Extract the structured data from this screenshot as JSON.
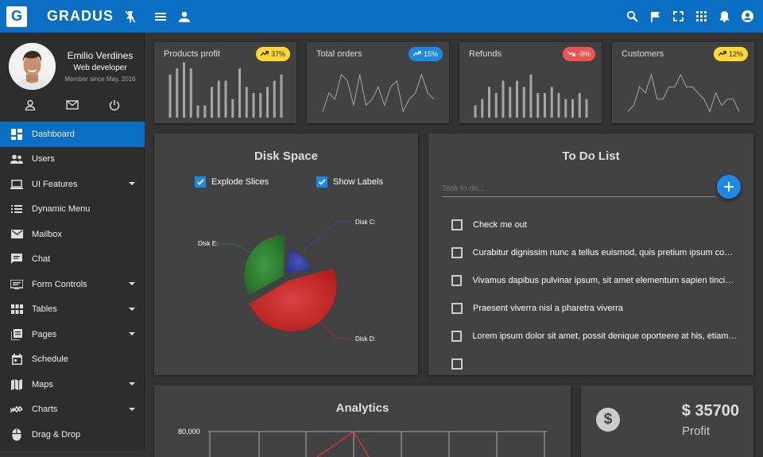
{
  "app": {
    "brand": "GRADUS",
    "logo_letter": "G"
  },
  "profile": {
    "name": "Emilio Verdines",
    "role": "Web developer",
    "member_since": "Member since May. 2016"
  },
  "sidebar": {
    "items": [
      {
        "label": "Dashboard",
        "icon": "dashboard-icon",
        "active": true
      },
      {
        "label": "Users",
        "icon": "users-icon"
      },
      {
        "label": "UI Features",
        "icon": "laptop-icon",
        "expand": true
      },
      {
        "label": "Dynamic Menu",
        "icon": "list-icon"
      },
      {
        "label": "Mailbox",
        "icon": "mail-icon"
      },
      {
        "label": "Chat",
        "icon": "chat-icon"
      },
      {
        "label": "Form Controls",
        "icon": "form-icon",
        "expand": true
      },
      {
        "label": "Tables",
        "icon": "table-icon",
        "expand": true
      },
      {
        "label": "Pages",
        "icon": "pages-icon",
        "expand": true
      },
      {
        "label": "Schedule",
        "icon": "calendar-icon"
      },
      {
        "label": "Maps",
        "icon": "map-icon",
        "expand": true
      },
      {
        "label": "Charts",
        "icon": "chart-icon",
        "expand": true
      },
      {
        "label": "Drag & Drop",
        "icon": "mouse-icon"
      }
    ]
  },
  "stats": [
    {
      "title": "Products profit",
      "badge": "37%",
      "trend": "up",
      "color": "#fdd835",
      "type": "bar",
      "values": [
        7,
        8,
        9,
        8,
        2,
        2,
        5,
        6,
        6,
        3,
        8,
        5,
        4,
        4,
        5,
        6,
        7
      ]
    },
    {
      "title": "Total orders",
      "badge": "15%",
      "trend": "up",
      "color": "#1e88e5",
      "type": "line",
      "values": [
        1,
        4,
        3,
        7,
        6,
        2,
        7,
        2,
        3,
        5,
        2,
        5,
        6,
        1,
        3,
        4,
        7,
        4,
        3
      ]
    },
    {
      "title": "Refunds",
      "badge": "-9%",
      "trend": "down",
      "color": "#ef5350",
      "type": "bar",
      "values": [
        2,
        3,
        5,
        4,
        6,
        5,
        6,
        5,
        7,
        4,
        4,
        5,
        4,
        3,
        3,
        4,
        3
      ]
    },
    {
      "title": "Customers",
      "badge": "12%",
      "trend": "up",
      "color": "#fdd835",
      "type": "line",
      "values": [
        1,
        2,
        5,
        4,
        7,
        3,
        3,
        5,
        5,
        7,
        5,
        5,
        4,
        3,
        1,
        4,
        2,
        3,
        3,
        1
      ]
    }
  ],
  "disk": {
    "title": "Disk Space",
    "explode_label": "Explode Slices",
    "labels_label": "Show Labels",
    "slices": [
      {
        "label": "Disk C:",
        "color": "#3949ab"
      },
      {
        "label": "Disk D:",
        "color": "#c62828"
      },
      {
        "label": "Disk E:",
        "color": "#2e7d32"
      }
    ]
  },
  "todo": {
    "title": "To Do List",
    "placeholder": "Task to do...",
    "items": [
      "Check me out",
      "Curabitur dignissim nunc a tellus euismod, quis pretium ipsum convallis",
      "Vivamus dapibus pulvinar ipsum, sit amet elementum sapien tincidunt ...",
      "Praesent viverra nisl a pharetra viverra",
      "Lorem ipsum dolor sit amet, possit denique oporteere at his, etiam corp..."
    ]
  },
  "analytics": {
    "title": "Analytics",
    "y_tick": "80,000"
  },
  "profit": {
    "value": "$ 35700",
    "label": "Profit"
  }
}
